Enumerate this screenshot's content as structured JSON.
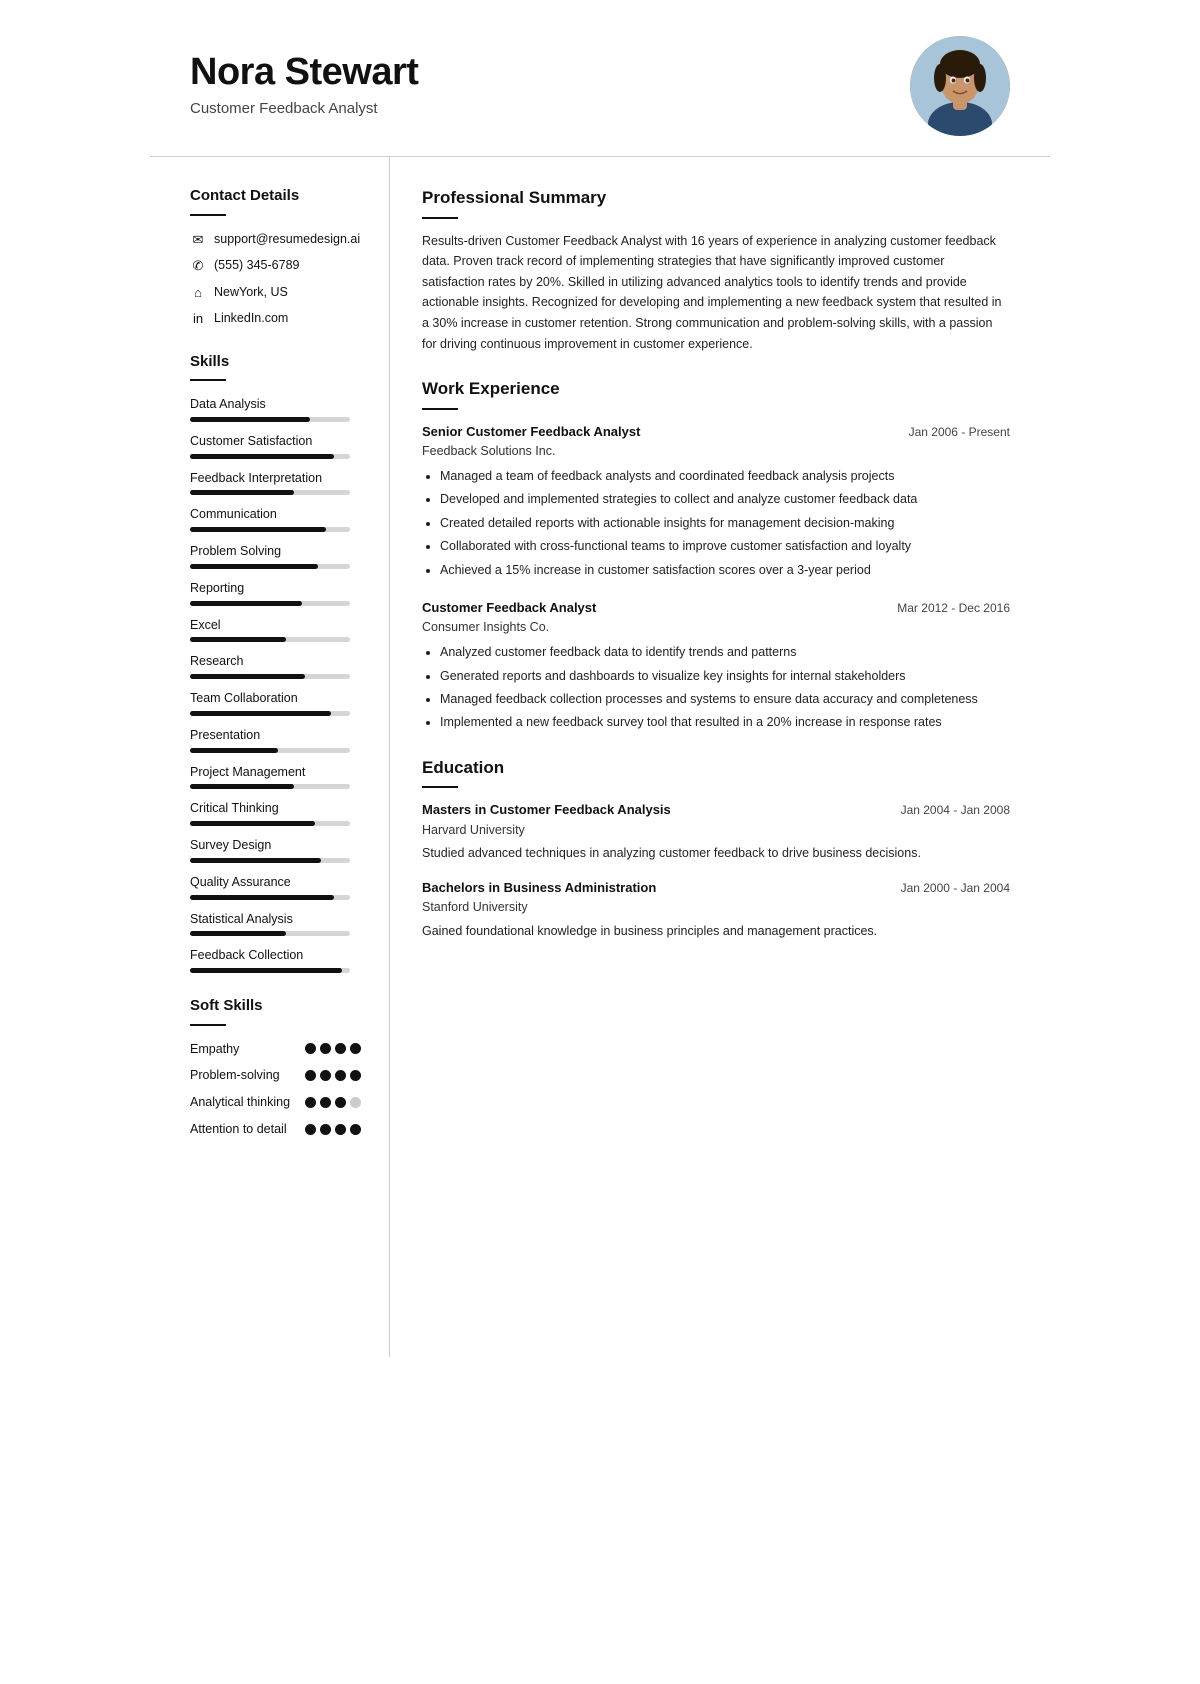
{
  "header": {
    "name": "Nora Stewart",
    "title": "Customer Feedback Analyst"
  },
  "contact": {
    "section_title": "Contact Details",
    "items": [
      {
        "icon": "✉",
        "text": "support@resumedesign.ai"
      },
      {
        "icon": "✆",
        "text": "(555) 345-6789"
      },
      {
        "icon": "⌂",
        "text": "NewYork, US"
      },
      {
        "icon": "in",
        "text": "LinkedIn.com"
      }
    ]
  },
  "skills": {
    "section_title": "Skills",
    "items": [
      {
        "name": "Data Analysis",
        "pct": 75
      },
      {
        "name": "Customer Satisfaction",
        "pct": 90
      },
      {
        "name": "Feedback Interpretation",
        "pct": 65
      },
      {
        "name": "Communication",
        "pct": 85
      },
      {
        "name": "Problem Solving",
        "pct": 80
      },
      {
        "name": "Reporting",
        "pct": 70
      },
      {
        "name": "Excel",
        "pct": 60
      },
      {
        "name": "Research",
        "pct": 72
      },
      {
        "name": "Team Collaboration",
        "pct": 88
      },
      {
        "name": "Presentation",
        "pct": 55
      },
      {
        "name": "Project Management",
        "pct": 65
      },
      {
        "name": "Critical Thinking",
        "pct": 78
      },
      {
        "name": "Survey Design",
        "pct": 82
      },
      {
        "name": "Quality Assurance",
        "pct": 90
      },
      {
        "name": "Statistical Analysis",
        "pct": 60
      },
      {
        "name": "Feedback Collection",
        "pct": 95
      }
    ]
  },
  "soft_skills": {
    "section_title": "Soft Skills",
    "items": [
      {
        "name": "Empathy",
        "filled": 4,
        "empty": 0
      },
      {
        "name": "Problem-solving",
        "filled": 4,
        "empty": 0
      },
      {
        "name": "Analytical thinking",
        "filled": 3,
        "empty": 1
      },
      {
        "name": "Attention to detail",
        "filled": 4,
        "empty": 0
      }
    ]
  },
  "summary": {
    "section_title": "Professional Summary",
    "text": "Results-driven Customer Feedback Analyst with 16 years of experience in analyzing customer feedback data. Proven track record of implementing strategies that have significantly improved customer satisfaction rates by 20%. Skilled in utilizing advanced analytics tools to identify trends and provide actionable insights. Recognized for developing and implementing a new feedback system that resulted in a 30% increase in customer retention. Strong communication and problem-solving skills, with a passion for driving continuous improvement in customer experience."
  },
  "work_experience": {
    "section_title": "Work Experience",
    "jobs": [
      {
        "title": "Senior Customer Feedback Analyst",
        "company": "Feedback Solutions Inc.",
        "dates": "Jan 2006 - Present",
        "bullets": [
          "Managed a team of feedback analysts and coordinated feedback analysis projects",
          "Developed and implemented strategies to collect and analyze customer feedback data",
          "Created detailed reports with actionable insights for management decision-making",
          "Collaborated with cross-functional teams to improve customer satisfaction and loyalty",
          "Achieved a 15% increase in customer satisfaction scores over a 3-year period"
        ]
      },
      {
        "title": "Customer Feedback Analyst",
        "company": "Consumer Insights Co.",
        "dates": "Mar 2012 - Dec 2016",
        "bullets": [
          "Analyzed customer feedback data to identify trends and patterns",
          "Generated reports and dashboards to visualize key insights for internal stakeholders",
          "Managed feedback collection processes and systems to ensure data accuracy and completeness",
          "Implemented a new feedback survey tool that resulted in a 20% increase in response rates"
        ]
      }
    ]
  },
  "education": {
    "section_title": "Education",
    "items": [
      {
        "degree": "Masters in Customer Feedback Analysis",
        "school": "Harvard University",
        "dates": "Jan 2004 - Jan 2008",
        "description": "Studied advanced techniques in analyzing customer feedback to drive business decisions."
      },
      {
        "degree": "Bachelors in Business Administration",
        "school": "Stanford University",
        "dates": "Jan 2000 - Jan 2004",
        "description": "Gained foundational knowledge in business principles and management practices."
      }
    ]
  }
}
